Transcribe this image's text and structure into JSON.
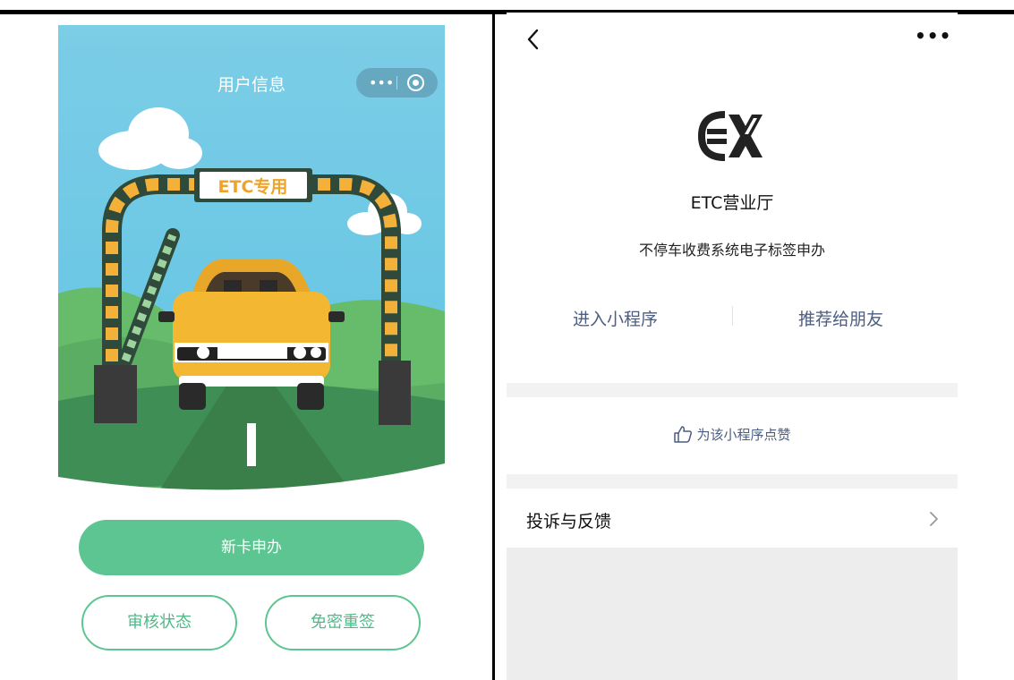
{
  "left_app": {
    "nav_title": "用户信息",
    "sign_text": "ETC专用",
    "primary_button": "新卡申办",
    "review_button": "审核状态",
    "resign_button": "免密重签",
    "capsule_more_icon": "more-dots-icon",
    "capsule_close_icon": "target-close-icon"
  },
  "right_app": {
    "back_icon": "chevron-left-icon",
    "more_icon": "more-dots-icon",
    "more_glyph": "•••",
    "app_name": "ETC营业厅",
    "app_desc": "不停车收费系统电子标签申办",
    "enter_label": "进入小程序",
    "share_label": "推荐给朋友",
    "like_label": "为该小程序点赞",
    "feedback_label": "投诉与反馈"
  },
  "colors": {
    "accent_green": "#5cc591",
    "link_blue": "#4b5d82",
    "sign_orange": "#f0a32a"
  }
}
